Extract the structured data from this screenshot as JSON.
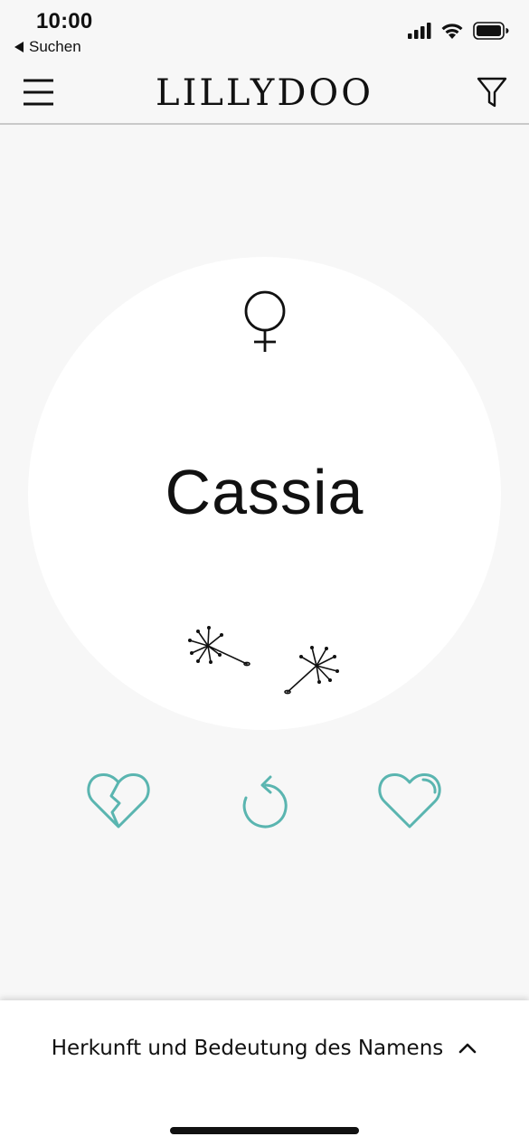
{
  "status_bar": {
    "time": "10:00",
    "back_label": "Suchen",
    "icons": [
      "cellular-signal-icon",
      "wifi-icon",
      "battery-icon"
    ]
  },
  "nav": {
    "brand": "LILLYDOO",
    "menu_icon": "hamburger-menu-icon",
    "filter_icon": "filter-funnel-icon"
  },
  "card": {
    "gender_icon": "female-symbol-icon",
    "name": "Cassia",
    "decoration_icon": "dandelion-seeds-icon"
  },
  "actions": {
    "dislike_icon": "broken-heart-icon",
    "undo_icon": "undo-arrow-icon",
    "like_icon": "heart-icon"
  },
  "sheet": {
    "title": "Herkunft und Bedeutung des Namens",
    "toggle_icon": "chevron-up-icon"
  },
  "colors": {
    "background": "#f7f7f7",
    "card": "#ffffff",
    "accent": "#5ab5b0",
    "text": "#111111"
  }
}
